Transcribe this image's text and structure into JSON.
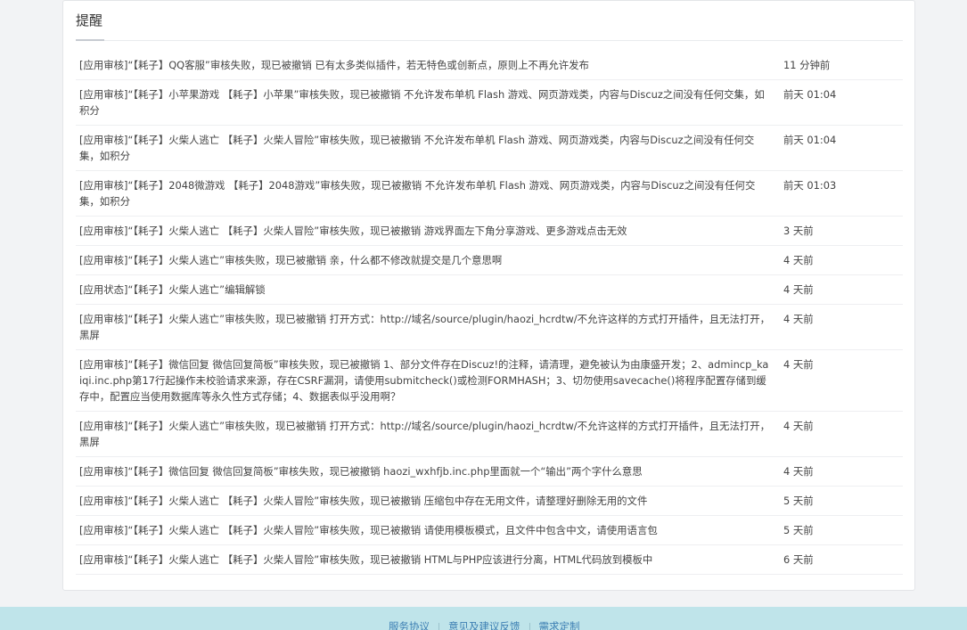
{
  "card": {
    "title": "提醒"
  },
  "notifications": [
    {
      "text": "[应用审核]“【耗子】QQ客服”审核失败，现已被撤销 已有太多类似插件，若无特色或创新点，原则上不再允许发布",
      "time": "11 分钟前"
    },
    {
      "text": "[应用审核]“【耗子】小苹果游戏 【耗子】小苹果”审核失败，现已被撤销 不允许发布单机 Flash 游戏、网页游戏类，内容与Discuz之间没有任何交集，如积分",
      "time": "前天 01:04"
    },
    {
      "text": "[应用审核]“【耗子】火柴人逃亡 【耗子】火柴人冒险”审核失败，现已被撤销 不允许发布单机 Flash 游戏、网页游戏类，内容与Discuz之间没有任何交集，如积分",
      "time": "前天 01:04"
    },
    {
      "text": "[应用审核]“【耗子】2048微游戏 【耗子】2048游戏”审核失败，现已被撤销 不允许发布单机 Flash 游戏、网页游戏类，内容与Discuz之间没有任何交集，如积分",
      "time": "前天 01:03"
    },
    {
      "text": "[应用审核]“【耗子】火柴人逃亡 【耗子】火柴人冒险”审核失败，现已被撤销 游戏界面左下角分享游戏、更多游戏点击无效",
      "time": "3 天前"
    },
    {
      "text": "[应用审核]“【耗子】火柴人逃亡”审核失败，现已被撤销 亲，什么都不修改就提交是几个意思啊",
      "time": "4 天前"
    },
    {
      "text": "[应用状态]“【耗子】火柴人逃亡”编辑解锁",
      "time": "4 天前"
    },
    {
      "text": "[应用审核]“【耗子】火柴人逃亡”审核失败，现已被撤销 打开方式：http://域名/source/plugin/haozi_hcrdtw/不允许这样的方式打开插件，且无法打开，黑屏",
      "time": "4 天前"
    },
    {
      "text": "[应用审核]“【耗子】微信回复 微信回复简板”审核失败，现已被撤销 1、部分文件存在Discuz!的注释，请清理，避免被认为由康盛开发；2、admincp_kaiqi.inc.php第17行起操作未校验请求来源，存在CSRF漏洞，请使用submitcheck()或检测FORMHASH；3、切勿使用savecache()将程序配置存储到缓存中，配置应当使用数据库等永久性方式存储；4、数据表似乎没用啊？",
      "time": "4 天前"
    },
    {
      "text": "[应用审核]“【耗子】火柴人逃亡”审核失败，现已被撤销 打开方式：http://域名/source/plugin/haozi_hcrdtw/不允许这样的方式打开插件，且无法打开，黑屏",
      "time": "4 天前"
    },
    {
      "text": "[应用审核]“【耗子】微信回复 微信回复简板”审核失败，现已被撤销 haozi_wxhfjb.inc.php里面就一个“输出”两个字什么意思",
      "time": "4 天前"
    },
    {
      "text": "[应用审核]“【耗子】火柴人逃亡 【耗子】火柴人冒险”审核失败，现已被撤销 压缩包中存在无用文件，请整理好删除无用的文件",
      "time": "5 天前"
    },
    {
      "text": "[应用审核]“【耗子】火柴人逃亡 【耗子】火柴人冒险”审核失败，现已被撤销 请使用模板模式，且文件中包含中文，请使用语言包",
      "time": "5 天前"
    },
    {
      "text": "[应用审核]“【耗子】火柴人逃亡 【耗子】火柴人冒险”审核失败，现已被撤销 HTML与PHP应该进行分离，HTML代码放到模板中",
      "time": "6 天前"
    }
  ],
  "footer": {
    "links": [
      "服务协议",
      "意见及建议反馈",
      "需求定制"
    ]
  }
}
